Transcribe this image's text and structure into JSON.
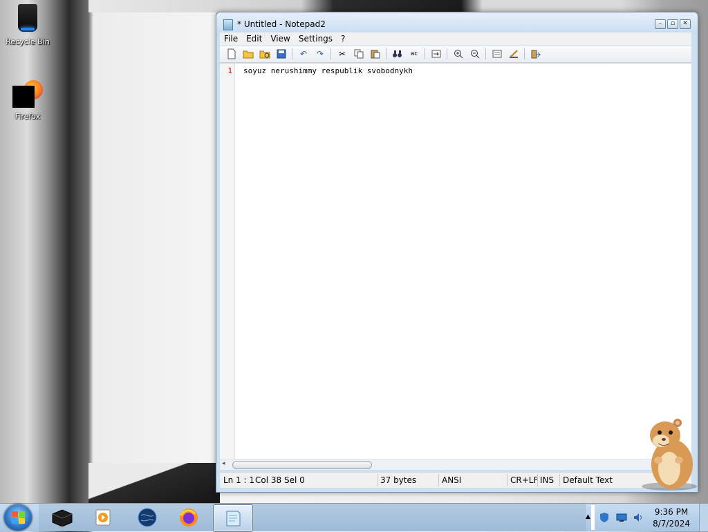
{
  "desktop": {
    "icons": [
      {
        "label": "Recycle Bin"
      },
      {
        "label": "Firefox"
      }
    ]
  },
  "window": {
    "title": "* Untitled - Notepad2",
    "menu": [
      "File",
      "Edit",
      "View",
      "Settings",
      "?"
    ],
    "toolbar_icons": [
      "new-file-icon",
      "open-icon",
      "browse-icon",
      "save-icon",
      "undo-icon",
      "redo-icon",
      "cut-icon",
      "copy-icon",
      "paste-icon",
      "find-icon",
      "replace-icon",
      "word-wrap-icon",
      "zoom-in-icon",
      "zoom-out-icon",
      "scheme-icon",
      "customize-icon",
      "exit-icon"
    ],
    "editor": {
      "line_numbers": [
        "1"
      ],
      "lines": [
        "soyuz nerushimmy respublik svobodnykh"
      ]
    },
    "statusbar": {
      "position": "Ln 1 : 1",
      "column": "Col 38",
      "selection": "Sel 0",
      "size": "37 bytes",
      "encoding": "ANSI",
      "line_endings": "CR+LF",
      "mode": "INS",
      "scheme": "Default Text"
    }
  },
  "taskbar": {
    "pinned": [
      "file-explorer-icon",
      "media-player-icon",
      "browser-globe-icon",
      "firefox-icon",
      "notepad2-icon"
    ],
    "clock": {
      "time": "9:36 PM",
      "date": "8/7/2024"
    }
  },
  "colors": {
    "accent": "#2f78c9",
    "line_number": "#c00000"
  }
}
